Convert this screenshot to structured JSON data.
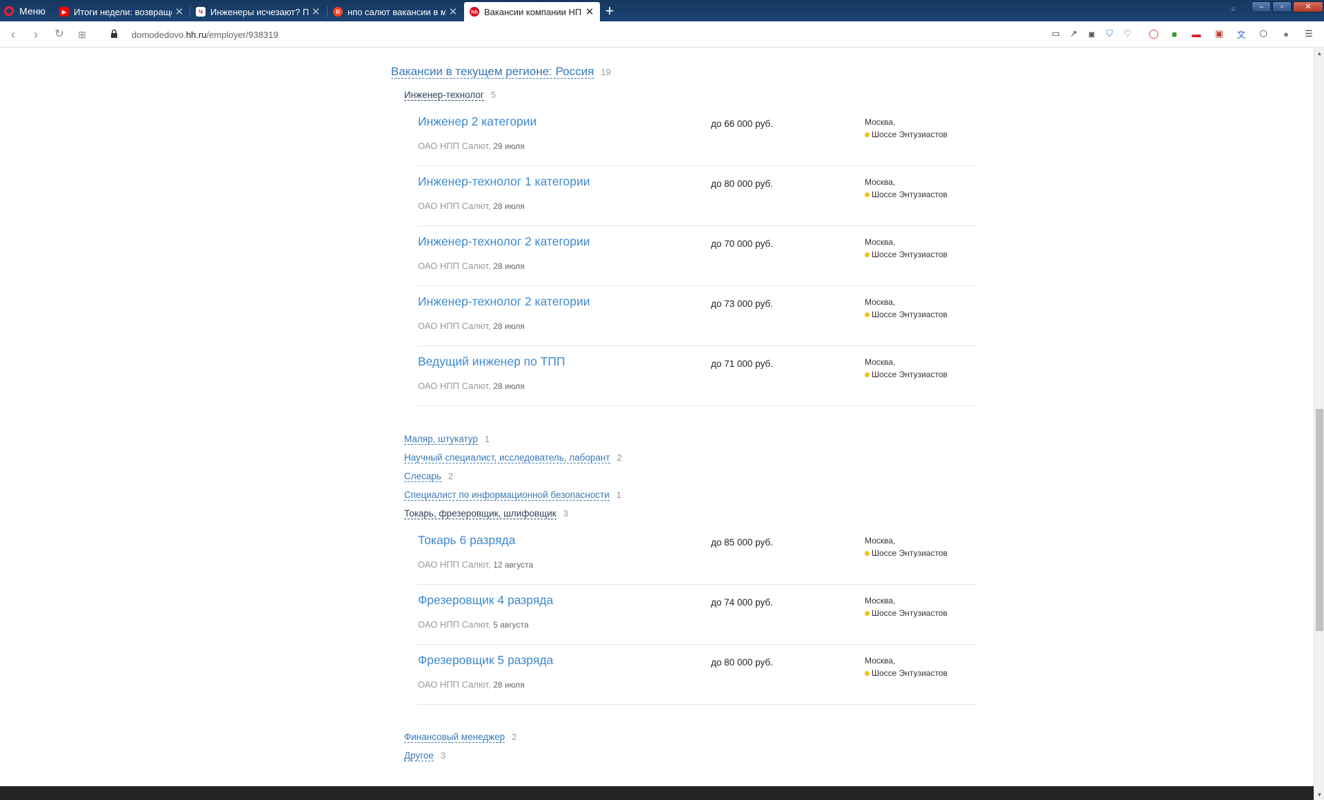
{
  "browser": {
    "menu_label": "Меню",
    "tabs": [
      {
        "label": "Итоги недели: возвращение",
        "favicon": "youtube-icon",
        "color": "#ff0000"
      },
      {
        "label": "Инженеры исчезают? Почему",
        "favicon": "habr-icon",
        "color": "#ffffff"
      },
      {
        "label": "нпо салют вакансии в москве",
        "favicon": "yandex-icon",
        "color": "#fc3f1d"
      },
      {
        "label": "Вакансии компании НПП Салют",
        "favicon": "hh-icon",
        "color": "#d6001c",
        "active": true
      }
    ],
    "url_prefix": "domodedovo.",
    "url_host": "hh.ru",
    "url_path": "/employer/938319"
  },
  "region": {
    "title": "Вакансии в текущем регионе: Россия",
    "count": "19"
  },
  "categories": [
    {
      "name": "Инженер-технолог",
      "count": "5",
      "open": true
    },
    {
      "name": "Маляр, штукатур",
      "count": "1"
    },
    {
      "name": "Научный специалист, исследователь, лаборант",
      "count": "2"
    },
    {
      "name": "Слесарь",
      "count": "2"
    },
    {
      "name": "Специалист по информационной безопасности",
      "count": "1"
    },
    {
      "name": "Токарь, фрезеровщик, шлифовщик",
      "count": "3",
      "open": true
    },
    {
      "name": "Финансовый менеджер",
      "count": "2"
    },
    {
      "name": "Другое",
      "count": "3"
    }
  ],
  "vacancies": [
    {
      "title": "Инженер 2 категории",
      "salary": "до 66 000 руб.",
      "city": "Москва,",
      "metro": "Шоссе Энтузиастов",
      "company": "ОАО НПП Салют",
      "date": "29 июля"
    },
    {
      "title": "Инженер-технолог 1 категории",
      "salary": "до 80 000 руб.",
      "city": "Москва,",
      "metro": "Шоссе Энтузиастов",
      "company": "ОАО НПП Салют",
      "date": "28 июля"
    },
    {
      "title": "Инженер-технолог 2 категории",
      "salary": "до 70 000 руб.",
      "city": "Москва,",
      "metro": "Шоссе Энтузиастов",
      "company": "ОАО НПП Салют",
      "date": "28 июля"
    },
    {
      "title": "Инженер-технолог 2 категории",
      "salary": "до 73 000 руб.",
      "city": "Москва,",
      "metro": "Шоссе Энтузиастов",
      "company": "ОАО НПП Салют",
      "date": "28 июля"
    },
    {
      "title": "Ведущий инженер по ТПП",
      "salary": "до 71 000 руб.",
      "city": "Москва,",
      "metro": "Шоссе Энтузиастов",
      "company": "ОАО НПП Салют",
      "date": "28 июля"
    },
    {
      "title": "Токарь 6 разряда",
      "salary": "до 85 000 руб.",
      "city": "Москва,",
      "metro": "Шоссе Энтузиастов",
      "company": "ОАО НПП Салют",
      "date": "12 августа"
    },
    {
      "title": "Фрезеровщик 4 разряда",
      "salary": "до 74 000 руб.",
      "city": "Москва,",
      "metro": "Шоссе Энтузиастов",
      "company": "ОАО НПП Салют",
      "date": "5 августа"
    },
    {
      "title": "Фрезеровщик 5 разряда",
      "salary": "до 80 000 руб.",
      "city": "Москва,",
      "metro": "Шоссе Энтузиастов",
      "company": "ОАО НПП Салют",
      "date": "28 июля"
    }
  ],
  "colors": {
    "link": "#3778b8",
    "metro_line": "#f0c21b",
    "tabbar": "#1d4474"
  }
}
